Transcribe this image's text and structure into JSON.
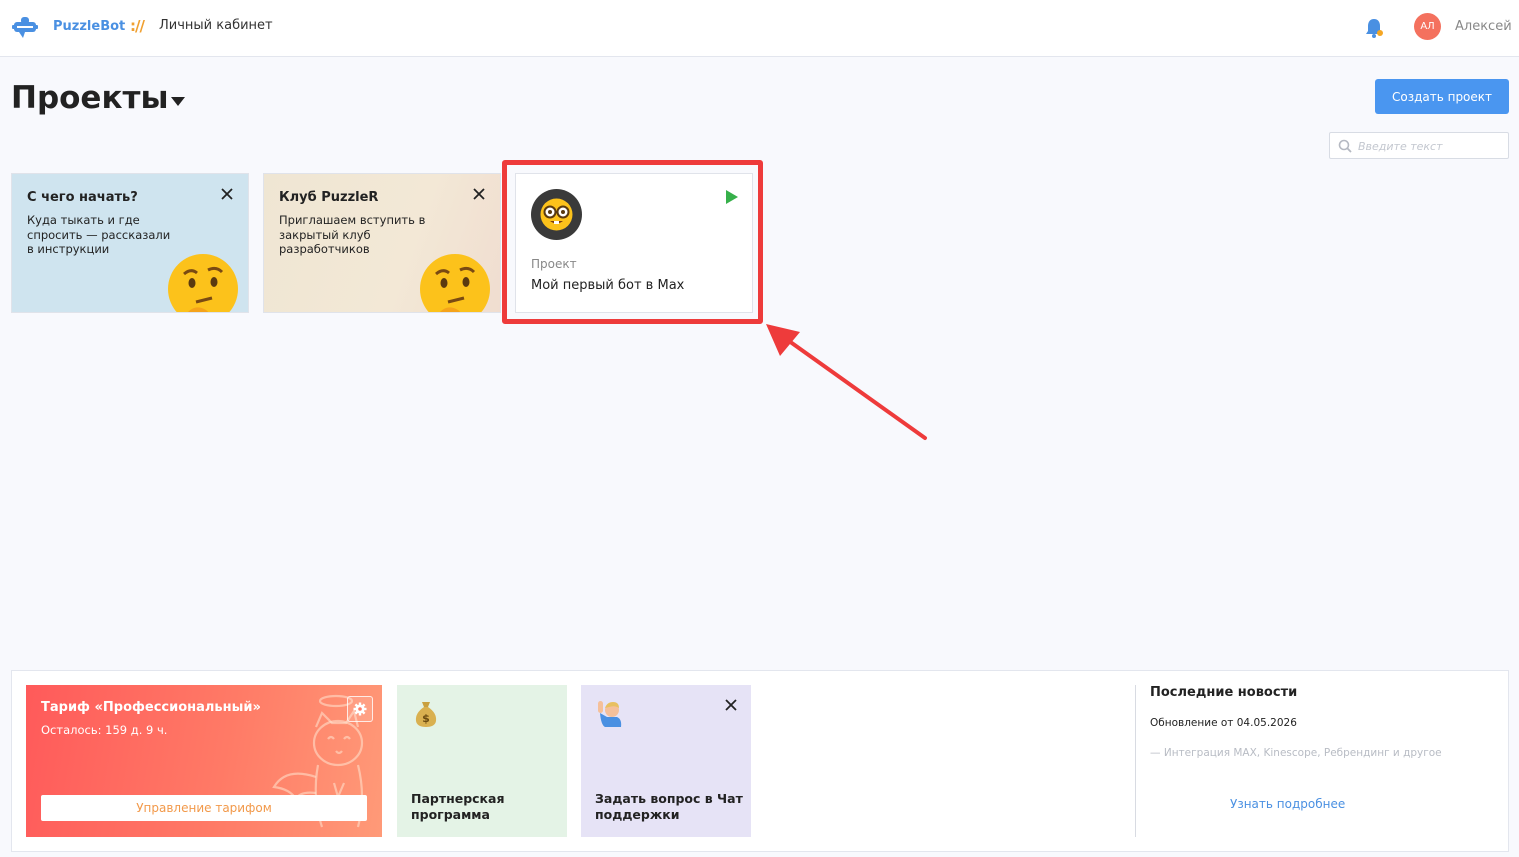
{
  "header": {
    "brand": "PuzzleBot",
    "separator": "://",
    "breadcrumb": "Личный кабинет",
    "user_initials": "АЛ",
    "user_name": "Алексей"
  },
  "page": {
    "title": "Проекты",
    "create_button": "Создать проект",
    "search_placeholder": "Введите текст"
  },
  "cards": {
    "start": {
      "title": "С чего начать?",
      "text": "Куда тыкать и где спросить — рассказали в инструкции"
    },
    "club": {
      "title": "Клуб PuzzleR",
      "text": "Приглашаем вступить в закрытый клуб разработчиков"
    },
    "project": {
      "label": "Проект",
      "name": "Мой первый бот в Max"
    }
  },
  "bottom": {
    "tariff": {
      "title": "Тариф «Профессиональный»",
      "remaining": "Осталось: 159 д. 9 ч.",
      "manage_button": "Управление тарифом"
    },
    "partner": {
      "text": "Партнерская программа"
    },
    "support": {
      "text": "Задать вопрос в Чат поддержки"
    },
    "news": {
      "title": "Последние новости",
      "date": "Обновление от 04.05.2026",
      "snippet": "— Интеграция MAX, Kinescope, Ребрендинг и другое",
      "more": "Узнать подробнее"
    }
  },
  "colors": {
    "accent": "#4a96f0",
    "highlight": "#ee3b3b",
    "play": "#36b04a",
    "tariff_gradient_start": "#ff5a5a",
    "tariff_button_text": "#f2994a"
  }
}
